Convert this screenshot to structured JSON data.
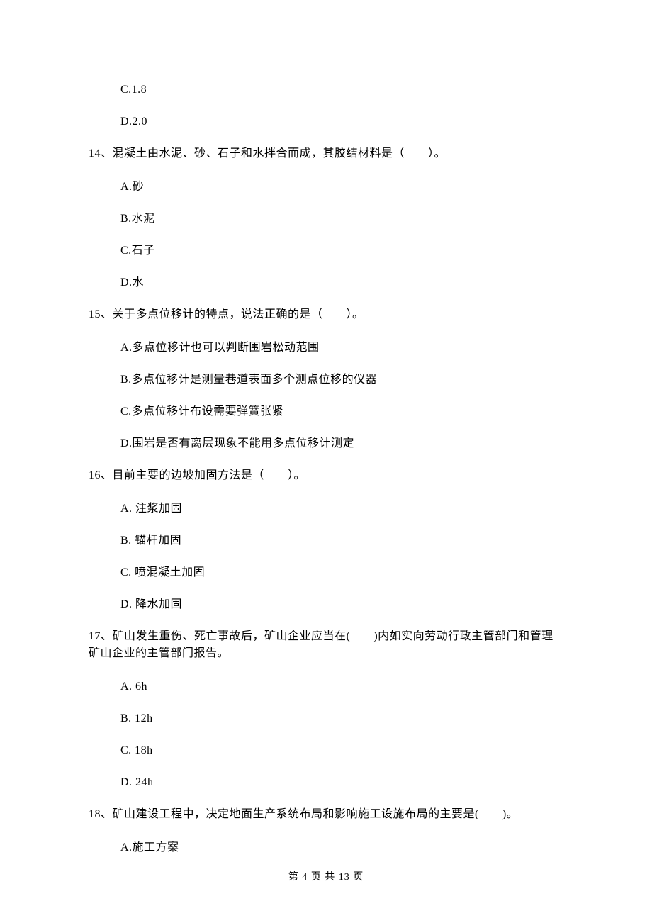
{
  "q13": {
    "options": {
      "c": "C.1.8",
      "d": "D.2.0"
    }
  },
  "q14": {
    "text": "14、混凝土由水泥、砂、石子和水拌合而成，其胶结材料是（　　）。",
    "options": {
      "a": "A.砂",
      "b": "B.水泥",
      "c": "C.石子",
      "d": "D.水"
    }
  },
  "q15": {
    "text": "15、关于多点位移计的特点，说法正确的是（　　）。",
    "options": {
      "a": "A.多点位移计也可以判断围岩松动范围",
      "b": "B.多点位移计是测量巷道表面多个测点位移的仪器",
      "c": "C.多点位移计布设需要弹簧张紧",
      "d": "D.围岩是否有离层现象不能用多点位移计测定"
    }
  },
  "q16": {
    "text": "16、目前主要的边坡加固方法是（　　）。",
    "options": {
      "a": "A. 注浆加固",
      "b": "B. 锚杆加固",
      "c": "C. 喷混凝土加固",
      "d": "D. 降水加固"
    }
  },
  "q17": {
    "text": "17、矿山发生重伤、死亡事故后，矿山企业应当在(　　)内如实向劳动行政主管部门和管理矿山企业的主管部门报告。",
    "options": {
      "a": "A. 6h",
      "b": "B. 12h",
      "c": "C. 18h",
      "d": "D. 24h"
    }
  },
  "q18": {
    "text": "18、矿山建设工程中，决定地面生产系统布局和影响施工设施布局的主要是(　　)。",
    "options": {
      "a": "A.施工方案"
    }
  },
  "footer": {
    "text": "第 4 页 共 13 页"
  }
}
